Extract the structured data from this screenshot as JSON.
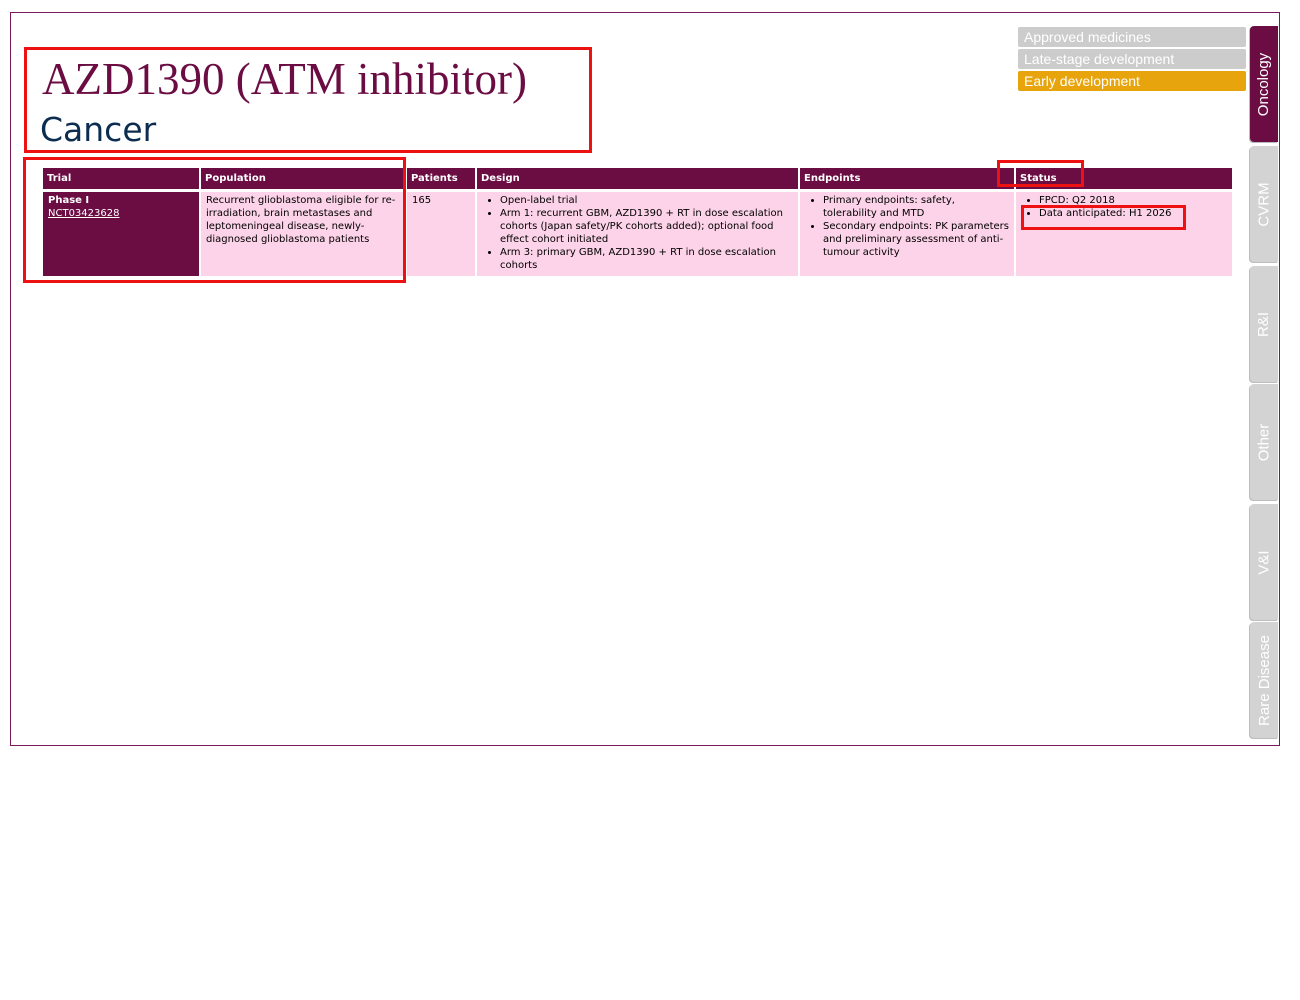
{
  "header": {
    "title": "AZD1390 (ATM inhibitor)",
    "subtitle": "Cancer"
  },
  "stages": [
    {
      "label": "Approved medicines",
      "active": false
    },
    {
      "label": "Late-stage development",
      "active": false
    },
    {
      "label": "Early development",
      "active": true
    }
  ],
  "tabs": [
    {
      "label": "Oncology",
      "active": true
    },
    {
      "label": "CVRM",
      "active": false
    },
    {
      "label": "R&I",
      "active": false
    },
    {
      "label": "Other",
      "active": false
    },
    {
      "label": "V&I",
      "active": false
    },
    {
      "label": "Rare Disease",
      "active": false
    }
  ],
  "table": {
    "headers": [
      "Trial",
      "Population",
      "Patients",
      "Design",
      "Endpoints",
      "Status"
    ],
    "row": {
      "trial_phase": "Phase I",
      "trial_id": "NCT03423628",
      "population": "Recurrent glioblastoma eligible for re-irradiation, brain metastases and leptomeningeal disease, newly-diagnosed glioblastoma patients",
      "patients": "165",
      "design": [
        "Open-label trial",
        "Arm 1: recurrent GBM, AZD1390 + RT in dose escalation cohorts (Japan safety/PK cohorts added); optional food effect cohort initiated",
        "Arm 3: primary GBM, AZD1390 + RT in dose escalation cohorts"
      ],
      "endpoints": [
        "Primary endpoints: safety, tolerability and MTD",
        "Secondary endpoints: PK parameters and preliminary assessment of anti-tumour activity"
      ],
      "status": [
        "FPCD: Q2 2018",
        "Data anticipated: H1 2026"
      ]
    }
  },
  "colors": {
    "brand": "#6b0d43",
    "row_fill": "#fcd3e8",
    "stage_active": "#e8a40c",
    "stage_inactive": "#cccccc",
    "annotation": "#ee1111"
  }
}
